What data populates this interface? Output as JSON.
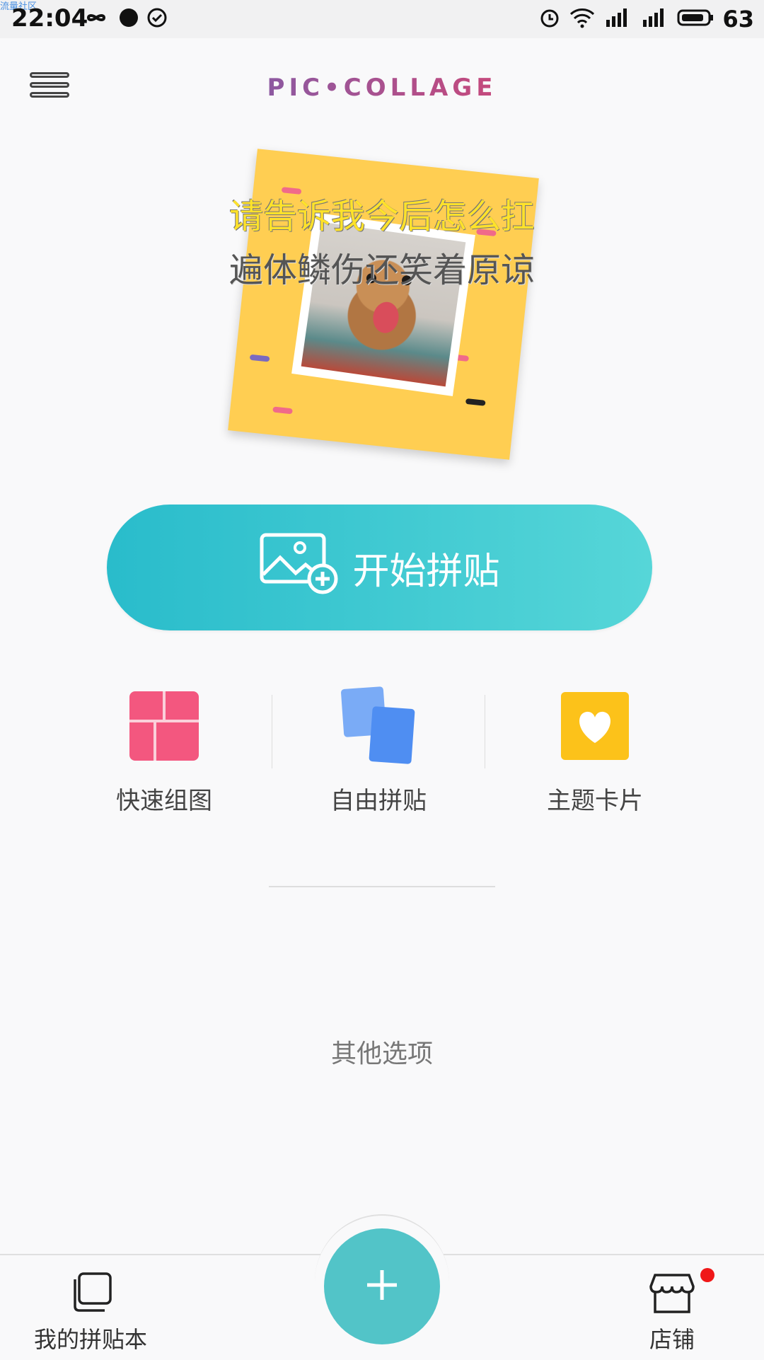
{
  "status_bar": {
    "watermark": "流量社区",
    "time": "22:04",
    "battery": "63"
  },
  "header": {
    "logo": "PIC•COLLAGE"
  },
  "hero": {
    "lyric_line1": "请告诉我今后怎么扛",
    "lyric_line2": "遍体鳞伤还笑着原谅"
  },
  "start_button": {
    "label": "开始拼贴"
  },
  "features": [
    {
      "label": "快速组图",
      "icon": "grid-layout-icon",
      "color": "#f3577f"
    },
    {
      "label": "自由拼贴",
      "icon": "freestyle-cards-icon",
      "color": "#5a99f5"
    },
    {
      "label": "主题卡片",
      "icon": "heart-card-icon",
      "color": "#fcc21a"
    }
  ],
  "other_options": "其他选项",
  "tabbar": {
    "left_label": "我的拼贴本",
    "right_label": "店铺"
  },
  "colors": {
    "accent": "#3cc3cc",
    "fab": "#52c4c8",
    "badge": "#f01818"
  }
}
